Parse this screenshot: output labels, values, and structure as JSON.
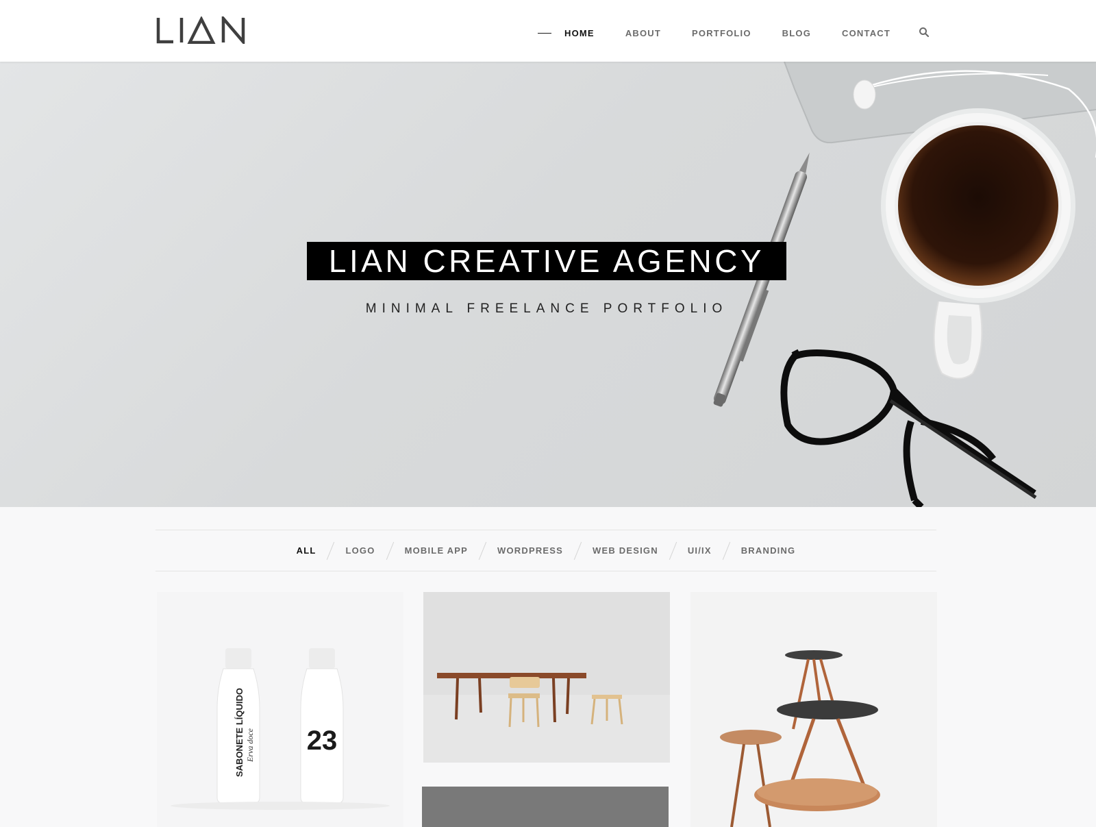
{
  "brand": {
    "logo_text": "LIAN"
  },
  "nav": {
    "items": [
      "HOME",
      "ABOUT",
      "PORTFOLIO",
      "BLOG",
      "CONTACT"
    ],
    "active": "HOME"
  },
  "hero": {
    "title": "LIAN CREATIVE AGENCY",
    "subtitle": "MINIMAL FREELANCE PORTFOLIO"
  },
  "filters": {
    "items": [
      "ALL",
      "LOGO",
      "MOBILE APP",
      "WORDPRESS",
      "WEB DESIGN",
      "UI/IX",
      "BRANDING"
    ],
    "active": "ALL"
  },
  "portfolio": {
    "bottle_label": "SABONETE LÍQUIDO",
    "bottle_sublabel": "Erva doce",
    "bottle_number": "23"
  },
  "colors": {
    "accent": "#111111",
    "nav_text": "#6b6b6b",
    "hero_bg": "#dcdedf",
    "page_bg": "#f8f8f9"
  },
  "icons": {
    "search": "search-icon"
  }
}
